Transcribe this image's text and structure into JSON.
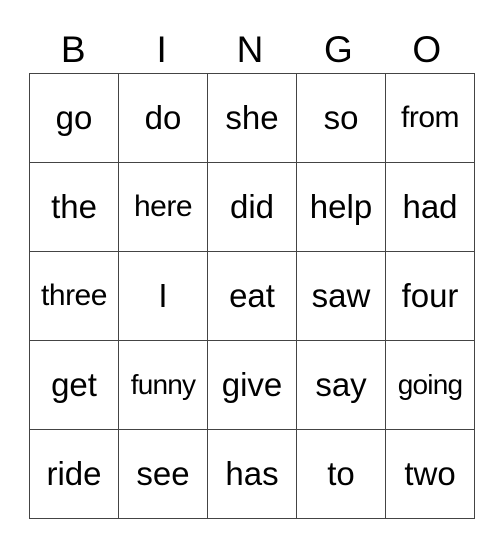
{
  "card": {
    "header": [
      "B",
      "I",
      "N",
      "G",
      "O"
    ],
    "rows": [
      [
        "go",
        "do",
        "she",
        "so",
        "from"
      ],
      [
        "the",
        "here",
        "did",
        "help",
        "had"
      ],
      [
        "three",
        "I",
        "eat",
        "saw",
        "four"
      ],
      [
        "get",
        "funny",
        "give",
        "say",
        "going"
      ],
      [
        "ride",
        "see",
        "has",
        "to",
        "two"
      ]
    ]
  }
}
